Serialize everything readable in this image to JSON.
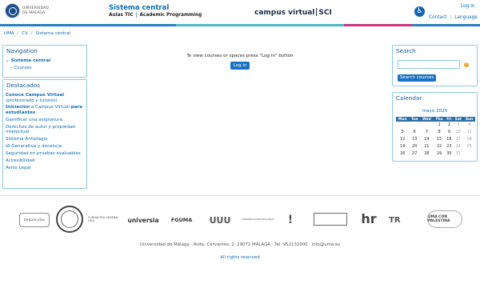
{
  "header": {
    "logo_line1": "UNIVERSIDAD",
    "logo_line2": "DE MÁLAGA",
    "site_title": "Sistema central",
    "subtitle_part1": "Aulas TIC",
    "subtitle_sep": "|",
    "subtitle_part2": "Academic Programming",
    "brand_part1": "campus virtual",
    "brand_part2": "SCI",
    "login_link": "Log in",
    "contact_link": "Contact",
    "language_link": "Language",
    "link_sep": "|"
  },
  "colors": {
    "bar": [
      "#2a7fc4",
      "#2a7fc4",
      "#4bb9c9",
      "#4bb9c9",
      "#c9377e",
      "#2a7fc4"
    ],
    "accent": "#0a6db5",
    "button": "#1a73c2"
  },
  "breadcrumb": {
    "items": [
      "UMA",
      "CV",
      "Sistema central"
    ],
    "sep": "/"
  },
  "navigation": {
    "title": "Navigation",
    "item1": "Sistema central",
    "item2": "Courses"
  },
  "destacados": {
    "title": "Destacados",
    "items": [
      {
        "bold": "Conoce Campus Virtual",
        "rest": "(profesorado y tutores)"
      },
      {
        "bold_a": "Iniciación",
        "mid": " a Campus Virtual ",
        "bold_b": "para estudiantes"
      },
      {
        "text": "Gamificar una asignatura"
      },
      {
        "text": "Derechos de autor y propiedad intelectual"
      },
      {
        "text": "Sistema Antiplagio"
      },
      {
        "text": "IA Generativa y docencia"
      },
      {
        "text": "Seguridad en pruebas evaluables"
      },
      {
        "text": "Accesibilidad"
      },
      {
        "text": "Aviso Legal"
      }
    ]
  },
  "main": {
    "message": "To view courses or spaces press \"Log in\" button",
    "login_button": "Log in"
  },
  "search": {
    "title": "Search",
    "placeholder": "",
    "button": "Search courses",
    "help_icon": "question-circle-icon"
  },
  "calendar": {
    "title": "Calendar",
    "month": "mayo 2025",
    "prev": "◄",
    "next": "►",
    "weekdays": [
      "Mon",
      "Tue",
      "Wed",
      "Thu",
      "Fri",
      "Sat",
      "Sun"
    ],
    "weeks": [
      [
        "",
        "",
        "",
        "1",
        "2",
        "3",
        "4"
      ],
      [
        "5",
        "6",
        "7",
        "8",
        "9",
        "10",
        "11"
      ],
      [
        "12",
        "13",
        "14",
        "15",
        "16",
        "17",
        "18"
      ],
      [
        "19",
        "20",
        "21",
        "22",
        "23",
        "24",
        "25"
      ],
      [
        "26",
        "27",
        "28",
        "29",
        "30",
        "31",
        ""
      ]
    ]
  },
  "footer": {
    "partners": [
      {
        "name": "bequal-logo",
        "text": "bequal plus"
      },
      {
        "name": "uma-seal-logo",
        "text": ""
      },
      {
        "name": "fundacion-logo",
        "text": "FUNDACIÓN GENERAL UMA"
      },
      {
        "name": "universia-logo",
        "text": "universia"
      },
      {
        "name": "fguma-logo",
        "text": "FGUMA"
      },
      {
        "name": "uuu-logo",
        "text": "UUU"
      },
      {
        "name": "comunicacion-inclusiva-logo",
        "text": "COMUNICACIÓN INCLUSIVA"
      },
      {
        "name": "bullet-logo",
        "text": "!"
      },
      {
        "name": "gvuf-logo",
        "text": ""
      },
      {
        "name": "hr-logo",
        "text": "hr"
      },
      {
        "name": "tr-logo",
        "text": "TR"
      },
      {
        "name": "uma-palestina-logo",
        "text": "UMA CON PALESTINA"
      }
    ],
    "address": "Universidad de Málaga · Avda. Cervantes, 2. 29071 MÁLAGA · Tel. 952131000 · info@uma.es",
    "rights": "All rights reserved"
  }
}
